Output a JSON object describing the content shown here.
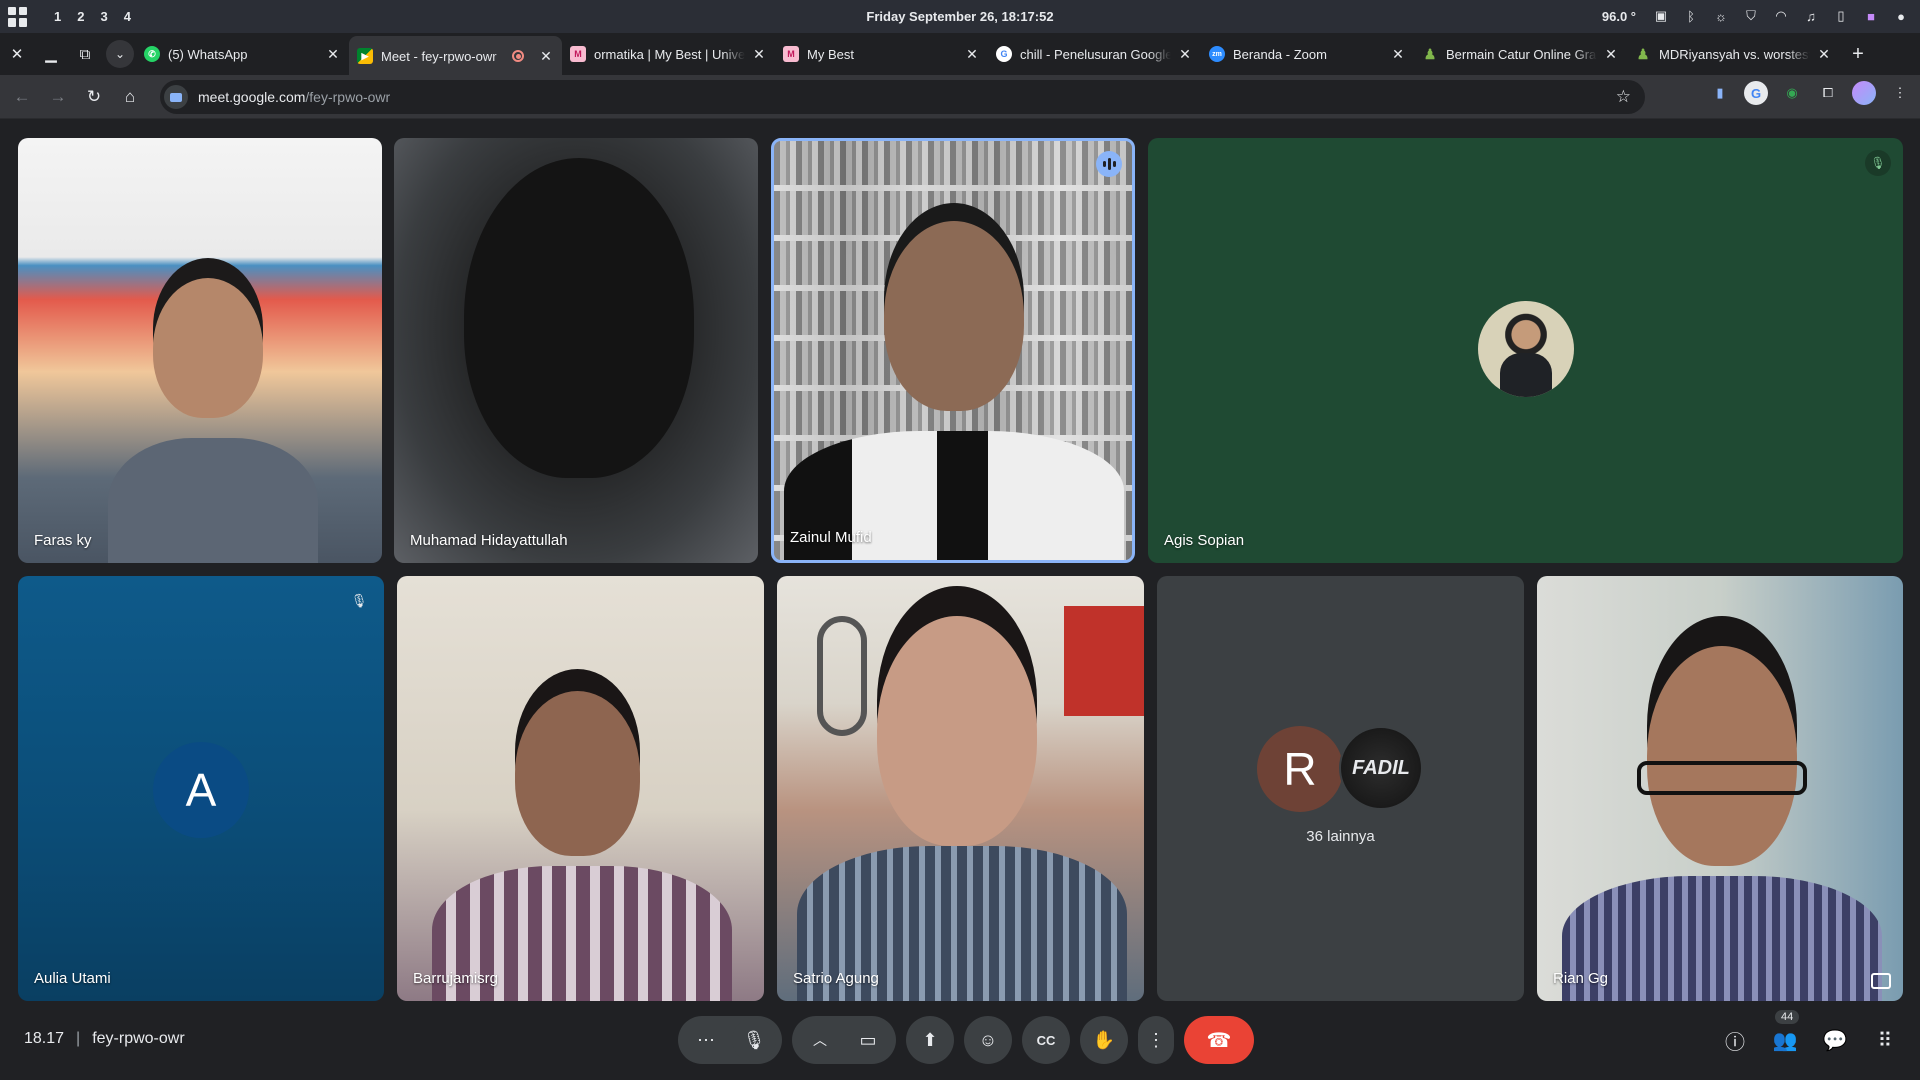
{
  "system": {
    "workspaces": [
      "1",
      "2",
      "3",
      "4"
    ],
    "clock": "Friday September 26, 18:17:52",
    "temperature": "96.0 °"
  },
  "tabs": [
    {
      "title": "(5) WhatsApp",
      "favicon": "whatsapp-icon",
      "color": "#25d366"
    },
    {
      "title": "Meet - fey-rpwo-owr",
      "favicon": "meet-icon",
      "color": "#00832d"
    },
    {
      "title": "ormatika | My Best | Universitas",
      "favicon": "mybest-icon",
      "color": "#c2185b"
    },
    {
      "title": "My Best",
      "favicon": "mybest-icon",
      "color": "#c2185b"
    },
    {
      "title": "chill - Penelusuran Google",
      "favicon": "google-icon",
      "color": "#4285f4"
    },
    {
      "title": "Beranda - Zoom",
      "favicon": "zoom-icon",
      "color": "#2d8cff"
    },
    {
      "title": "Bermain Catur Online Gratis",
      "favicon": "chess-icon",
      "color": "#81b64c"
    },
    {
      "title": "MDRiyansyah vs. worstest",
      "favicon": "chess-icon",
      "color": "#81b64c"
    }
  ],
  "omnibox": {
    "host": "meet.google.com",
    "path": "/fey-rpwo-owr"
  },
  "participants": [
    {
      "name": "Faras ky"
    },
    {
      "name": "Muhamad Hidayattullah"
    },
    {
      "name": "Zainul Mufid"
    },
    {
      "name": "Agis Sopian"
    },
    {
      "name": "Aulia Utami",
      "initial": "A"
    },
    {
      "name": "Barrujamisrg"
    },
    {
      "name": "Satrio Agung"
    },
    {
      "name": "Rian Gg"
    }
  ],
  "more": {
    "initial": "R",
    "fadil_label": "FADIL",
    "count_label": "36 lainnya"
  },
  "meeting": {
    "time": "18.17",
    "separator": "|",
    "code": "fey-rpwo-owr",
    "participant_count": "44"
  },
  "colors": {
    "end_call": "#ea4335",
    "speaking": "#8ab4f8",
    "aulia_bg": "#0b5389",
    "agis_bg": "#1f4a33"
  }
}
